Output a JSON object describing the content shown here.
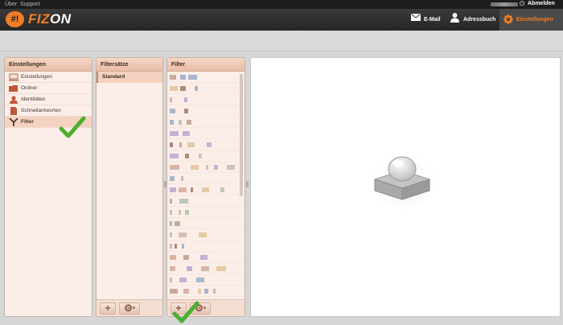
{
  "topbar": {
    "links": [
      "Über",
      "Support"
    ],
    "logout_label": "Abmelden"
  },
  "header": {
    "logo_badge": "#!",
    "logo_part1": "FIZ",
    "logo_part2": "ON",
    "nav": [
      {
        "label": "E-Mail",
        "icon": "envelope-icon",
        "active": false
      },
      {
        "label": "Adressbuch",
        "icon": "person-icon",
        "active": false
      },
      {
        "label": "Einstellungen",
        "icon": "gear-icon",
        "active": true
      }
    ]
  },
  "settings_panel": {
    "title": "Einstellungen",
    "items": [
      {
        "label": "Einstellungen",
        "icon": "monitor-icon"
      },
      {
        "label": "Ordner",
        "icon": "folder-icon"
      },
      {
        "label": "Identitäten",
        "icon": "identity-icon"
      },
      {
        "label": "Schnellantworten",
        "icon": "document-icon"
      },
      {
        "label": "Filter",
        "icon": "filter-icon",
        "active": true
      }
    ]
  },
  "filtersets_panel": {
    "title": "Filtersätze",
    "items": [
      "Standard"
    ],
    "add_label": "+",
    "gear_label": "⚙"
  },
  "filter_panel": {
    "title": "Filter",
    "add_label": "+",
    "gear_label": "⚙"
  },
  "colors": {
    "accent": "#f07e26",
    "panel_bg": "#fbeee8",
    "panel_head": "#ecc4b0",
    "checkmark": "#4caf2e"
  }
}
